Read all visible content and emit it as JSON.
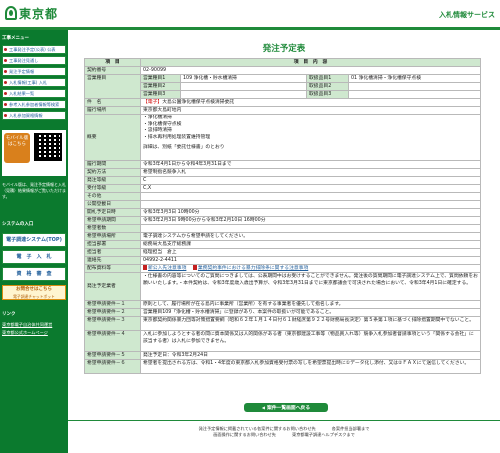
{
  "header": {
    "logo_text": "東京都",
    "service_title": "入札情報サービス"
  },
  "sidebar": {
    "menu_head": "工事メニュー",
    "items": [
      {
        "label": "工事発注予定(公表) 公表"
      },
      {
        "label": "工事発注見通し"
      },
      {
        "label": "発注予定情報"
      },
      {
        "label": "入札情報(工事) 入札"
      },
      {
        "label": "入札結果一覧"
      },
      {
        "label": "参考入札参加者情報等検索"
      },
      {
        "label": "入札参加資格情報"
      }
    ],
    "mobile_label": "モバイル版はこちら",
    "mobile_note": "モバイル版は、発注予定情報と入札（見積）結果情報がご覧いただけます。",
    "system_head": "システムの入口",
    "big_items": [
      {
        "label": "電子調達システム(TOP)"
      },
      {
        "label": "電　子　入　札"
      },
      {
        "label": "資　格　審　査"
      }
    ],
    "inquiry_label": "お問合せはこちら",
    "inquiry_sub": "電子調達チャットボット",
    "links_head": "リンク",
    "links": [
      {
        "label": "東京都電子自治体共同運営"
      },
      {
        "label": "東京都公式ホームページ"
      }
    ]
  },
  "main": {
    "page_title": "発注予定表",
    "col_item": "項　目",
    "col_content": "項　目　内　容",
    "contract_no_label": "契約番号",
    "contract_no": "02-90099",
    "business_label": "営業種目",
    "biz_rows": [
      {
        "label": "営業種目1",
        "value": "109 浄化槽・貯水槽清掃",
        "sub_label": "取扱品目1",
        "sub_value": "01 浄化槽清掃・浄化槽保守点検"
      },
      {
        "label": "営業種目2",
        "value": "",
        "sub_label": "取扱品目2",
        "sub_value": ""
      },
      {
        "label": "営業種目3",
        "value": "",
        "sub_label": "取扱品目3",
        "sub_value": ""
      }
    ],
    "name_label": "件　名",
    "name_tag": "【電子】",
    "name_value": "大島公園浄化槽保守点検清掃委託",
    "place_label": "履行場所",
    "place_value": "東京都大島町地内",
    "summary_label": "概要",
    "summary_lines": [
      "・浄化槽清掃",
      "・浄化槽保守点検",
      "・汲排時清掃",
      "・排水再利用処理装置維持管理",
      "",
      "詳細は、別紙「委託仕様書」のとおり"
    ],
    "rows": [
      {
        "label": "履行期間",
        "value": "令和3年4月1日から令和4年3月31日まで"
      },
      {
        "label": "契約方法",
        "value": "希望制指名競争入札"
      },
      {
        "label": "発注等級",
        "value": "C"
      },
      {
        "label": "受付等級",
        "value": "C,X"
      },
      {
        "label": "その他",
        "value": ""
      },
      {
        "label": "公開登載日",
        "value": ""
      },
      {
        "label": "開札予定日時",
        "value": "令和3年3月3日 10時00分"
      },
      {
        "label": "希望申請期間",
        "value": "令和3年2月3日 9時00分から令和3年2月10日 16時00分"
      },
      {
        "label": "希望者数",
        "value": ""
      },
      {
        "label": "希望申請場所",
        "value": "電子調達システムから希望申請をしてください。"
      },
      {
        "label": "担当部署",
        "value": "総務局大島支庁総務課"
      },
      {
        "label": "担当者",
        "value": "経理担当　倉上"
      },
      {
        "label": "連絡先",
        "value": "04992-2-4411"
      }
    ],
    "docs_label": "配布資料等",
    "docs": [
      {
        "label": "新公入先注意事項"
      },
      {
        "label": "業務契約事件における暴力排除条に関する注意事項"
      }
    ],
    "expected_label": "発注予定業者",
    "expected_value": "・仕様書の内容等についてのご質問につきましては、公表期間中はお受けすることができません。発注後の質問期間に電子調達システム上で、質問依頼をお願いいたします。・本件契約は、令和3年度歳入歳出予算が、令和3年3月31日までに東京都議会で可決された場合において、令和3年4月1日に確定する。",
    "conditions": [
      {
        "label": "希望申請要件－１",
        "value": "原則として、履行場所が在る島内に事業所（営業所）を有する事業者を優先して指名します。"
      },
      {
        "label": "希望申請要件－２",
        "value": "営業種目109「浄化槽・貯水槽清掃」に登録があり、本案件の取扱いが可能であること。"
      },
      {
        "label": "希望申請要件－３",
        "value": "東京都契約関係暴力団等対策措置要綱（昭和６２年１月１４日付６１財経庶第９２２号財務局長決定）第５条第１項に基づく排除措置期間中でないこと。"
      },
      {
        "label": "希望申請要件－４",
        "value": "入札に参加しようとする者の間に資本関係又は人的関係がある者（東京都建設工事等（物品買入れ等）競争入札参加者督請事項という「関係する会社」に該当する者）は入札に参加できません。"
      },
      {
        "label": "希望申請要件－５",
        "value": "発注予定日：令和3年2月24日"
      },
      {
        "label": "希望申請要件－６",
        "value": "希望者を提出される方は、令和1・4年度の東京都入札参加資格受付票の写しを希望票提出時に①データ化し添付、又は②ＦＡＸにて送信してください。"
      }
    ],
    "back_button": "案件一覧画面へ戻る"
  },
  "footer": {
    "line1_left": "発注予定情報に掲載されている各案件に関するお問い合わせ先",
    "line1_right": "各案件担当部署まで",
    "line2_left": "画面操作に関するお問い合わせ先",
    "line2_right": "東京都電子調達ヘルプデスクまで"
  },
  "colors": {
    "brand_green": "#1f8a3a",
    "sidebar_green": "#0b7a2e",
    "label_bg": "#cfe8cf"
  }
}
